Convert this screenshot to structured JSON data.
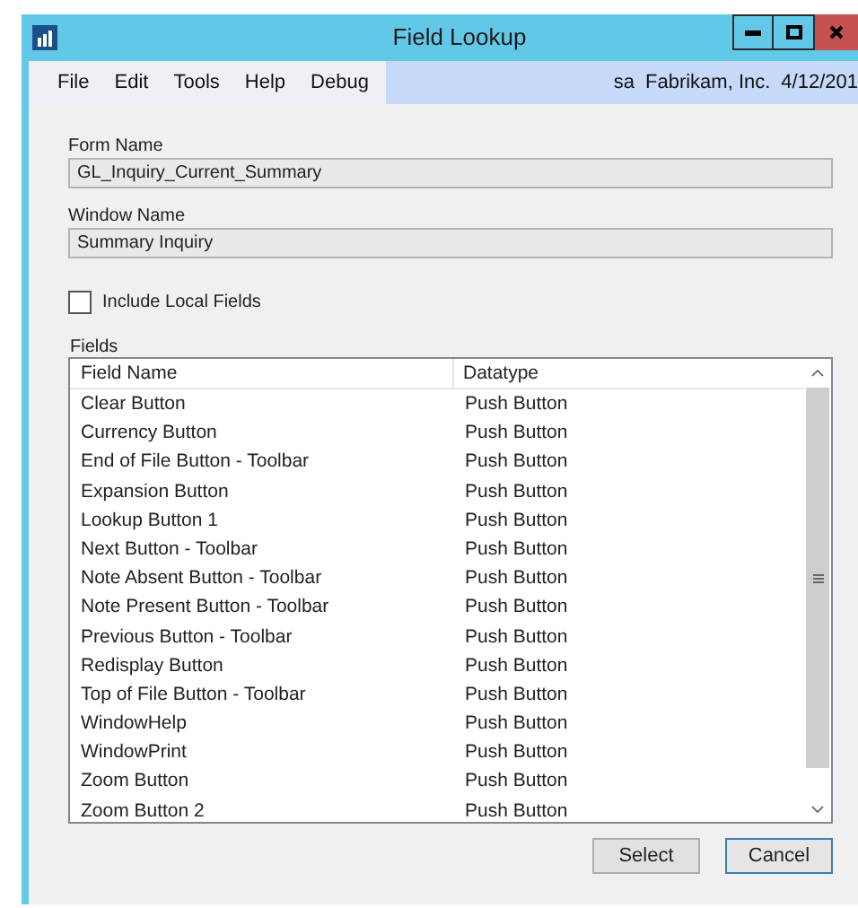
{
  "window": {
    "title": "Field Lookup"
  },
  "menu": [
    "File",
    "Edit",
    "Tools",
    "Help",
    "Debug"
  ],
  "status": {
    "user": "sa",
    "company": "Fabrikam, Inc.",
    "date": "4/12/201"
  },
  "form_name": {
    "label": "Form Name",
    "value": "GL_Inquiry_Current_Summary"
  },
  "window_name": {
    "label": "Window Name",
    "value": "Summary Inquiry"
  },
  "include_local_fields": {
    "label": "Include Local Fields",
    "checked": false
  },
  "fields": {
    "label": "Fields",
    "columns": [
      "Field Name",
      "Datatype"
    ],
    "rows": [
      [
        "Clear Button",
        "Push Button"
      ],
      [
        "Currency Button",
        "Push Button"
      ],
      [
        "End of File Button - Toolbar",
        "Push Button"
      ],
      [
        "Expansion Button",
        "Push Button"
      ],
      [
        "Lookup Button 1",
        "Push Button"
      ],
      [
        "Next Button - Toolbar",
        "Push Button"
      ],
      [
        "Note Absent Button - Toolbar",
        "Push Button"
      ],
      [
        "Note Present Button - Toolbar",
        "Push Button"
      ],
      [
        "Previous Button - Toolbar",
        "Push Button"
      ],
      [
        "Redisplay Button",
        "Push Button"
      ],
      [
        "Top of File Button - Toolbar",
        "Push Button"
      ],
      [
        "WindowHelp",
        "Push Button"
      ],
      [
        "WindowPrint",
        "Push Button"
      ],
      [
        "Zoom Button",
        "Push Button"
      ],
      [
        "Zoom Button 2",
        "Push Button"
      ]
    ]
  },
  "buttons": [
    "Select",
    "Cancel"
  ]
}
